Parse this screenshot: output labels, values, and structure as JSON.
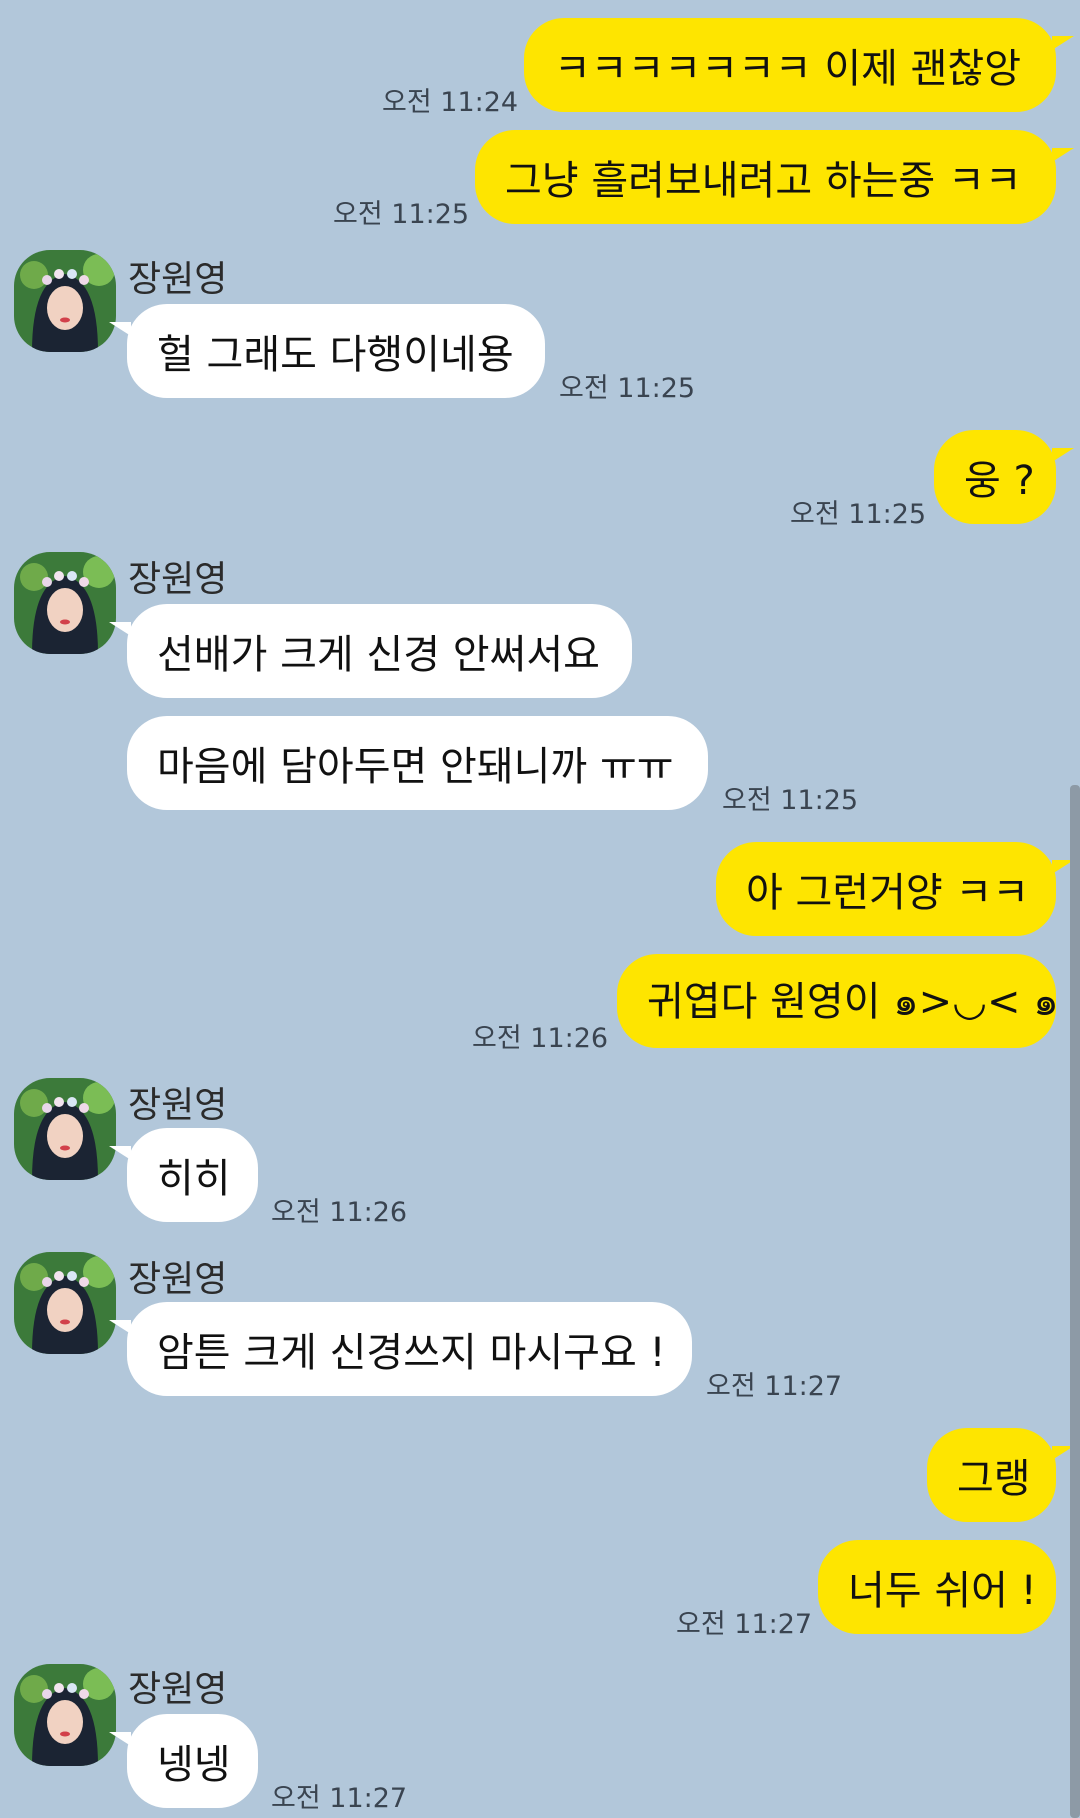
{
  "chat": {
    "partner_name": "장원영",
    "avatar_icon": "profile-photo-avatar-icon",
    "colors": {
      "background": "#b2c7da",
      "my_bubble": "#fee500",
      "their_bubble": "#ffffff"
    },
    "messages": [
      {
        "from": "me",
        "text": "ㅋㅋㅋㅋㅋㅋㅋ 이제 괜찮앙",
        "time": "오전 11:24"
      },
      {
        "from": "me",
        "text": "그냥 흘려보내려고 하는중 ㅋㅋ",
        "time": "오전 11:25"
      },
      {
        "from": "them",
        "text": "헐 그래도 다행이네용",
        "time": "오전 11:25"
      },
      {
        "from": "me",
        "text": "웅 ?",
        "time": "오전 11:25"
      },
      {
        "from": "them",
        "text": "선배가 크게 신경 안써서요",
        "time": ""
      },
      {
        "from": "them",
        "text": "마음에 담아두면 안돼니까 ㅠㅠ",
        "time": "오전 11:25"
      },
      {
        "from": "me",
        "text": "아 그런거양 ㅋㅋ",
        "time": ""
      },
      {
        "from": "me",
        "text": "귀엽다 원영이 ๑>◡< ๑",
        "time": "오전 11:26"
      },
      {
        "from": "them",
        "text": "히히",
        "time": "오전 11:26"
      },
      {
        "from": "them",
        "text": "암튼 크게 신경쓰지 마시구요 !",
        "time": "오전 11:27"
      },
      {
        "from": "me",
        "text": "그랭",
        "time": ""
      },
      {
        "from": "me",
        "text": "너두 쉬어 !",
        "time": "오전 11:27"
      },
      {
        "from": "them",
        "text": "넹넹",
        "time": "오전 11:27"
      }
    ]
  }
}
